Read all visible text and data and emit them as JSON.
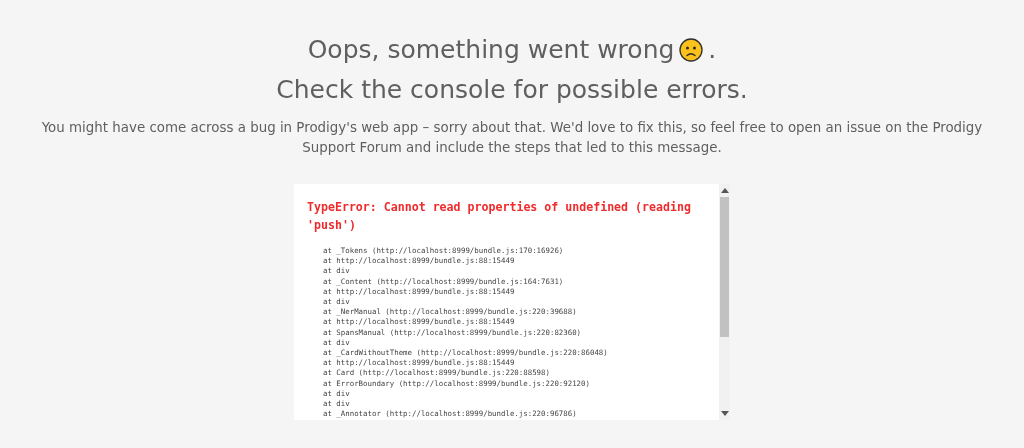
{
  "heading": {
    "line_1": "Oops, something went wrong",
    "line_1_end": ".",
    "line_2": "Check the console for possible errors."
  },
  "message": "You might have come across a bug in Prodigy's web app – sorry about that. We'd love to fix this, so feel free to open an issue on the Prodigy Support Forum and include the steps that led to this message.",
  "error_box": {
    "error": "TypeError: Cannot read properties of undefined (reading 'push')",
    "stack": [
      "at _Tokens (http://localhost:8999/bundle.js:170:16926)",
      "at http://localhost:8999/bundle.js:88:15449",
      "at div",
      "at _Content (http://localhost:8999/bundle.js:164:7631)",
      "at http://localhost:8999/bundle.js:88:15449",
      "at div",
      "at _NerManual (http://localhost:8999/bundle.js:220:39688)",
      "at http://localhost:8999/bundle.js:88:15449",
      "at SpansManual (http://localhost:8999/bundle.js:220:82360)",
      "at div",
      "at _CardWithoutTheme (http://localhost:8999/bundle.js:220:86048)",
      "at http://localhost:8999/bundle.js:88:15449",
      "at Card (http://localhost:8999/bundle.js:220:88598)",
      "at ErrorBoundary (http://localhost:8999/bundle.js:220:92120)",
      "at div",
      "at div",
      "at _Annotator (http://localhost:8999/bundle.js:220:96786)"
    ]
  }
}
